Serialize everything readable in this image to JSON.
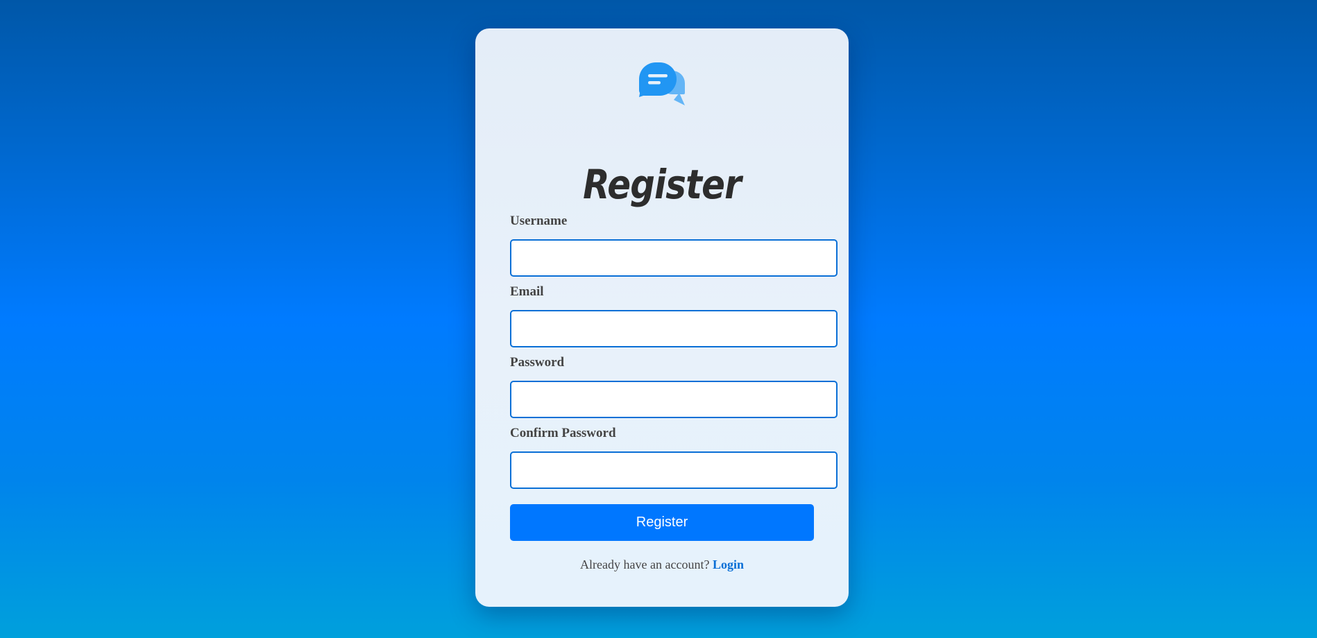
{
  "page": {
    "title": "Register"
  },
  "logo": {
    "icon": "chat-bubbles-icon",
    "colors": {
      "front": "#2196f3",
      "back": "#64b5f6"
    }
  },
  "form": {
    "fields": [
      {
        "label": "Username",
        "value": "",
        "type": "text"
      },
      {
        "label": "Email",
        "value": "",
        "type": "email"
      },
      {
        "label": "Password",
        "value": "",
        "type": "password"
      },
      {
        "label": "Confirm Password",
        "value": "",
        "type": "password"
      }
    ],
    "submit_label": "Register"
  },
  "footer": {
    "prompt": "Already have an account?",
    "link_label": "Login"
  },
  "colors": {
    "accent": "#0077ff",
    "input_border": "#0a6fd6",
    "title_text": "#2d2d2d"
  }
}
